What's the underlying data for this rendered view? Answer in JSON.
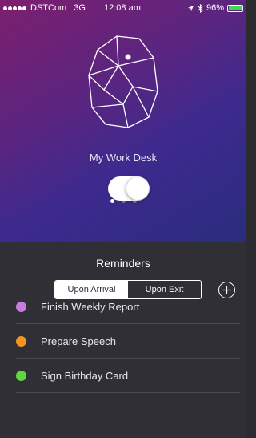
{
  "status_bar": {
    "carrier": "DSTCom",
    "network": "3G",
    "time": "12:08 am",
    "battery": "96%"
  },
  "beacon": {
    "name": "My Work Desk",
    "toggle_on": true,
    "page_count": 3,
    "active_page": 1
  },
  "reminders": {
    "title": "Reminders",
    "tabs": [
      {
        "label": "Upon Arrival",
        "active": true
      },
      {
        "label": "Upon Exit",
        "active": false
      }
    ],
    "items": [
      {
        "label": "Finish Weekly Report",
        "color": "#c77de0"
      },
      {
        "label": "Prepare Speech",
        "color": "#f5941e"
      },
      {
        "label": "Sign Birthday Card",
        "color": "#5fd83c"
      }
    ]
  }
}
